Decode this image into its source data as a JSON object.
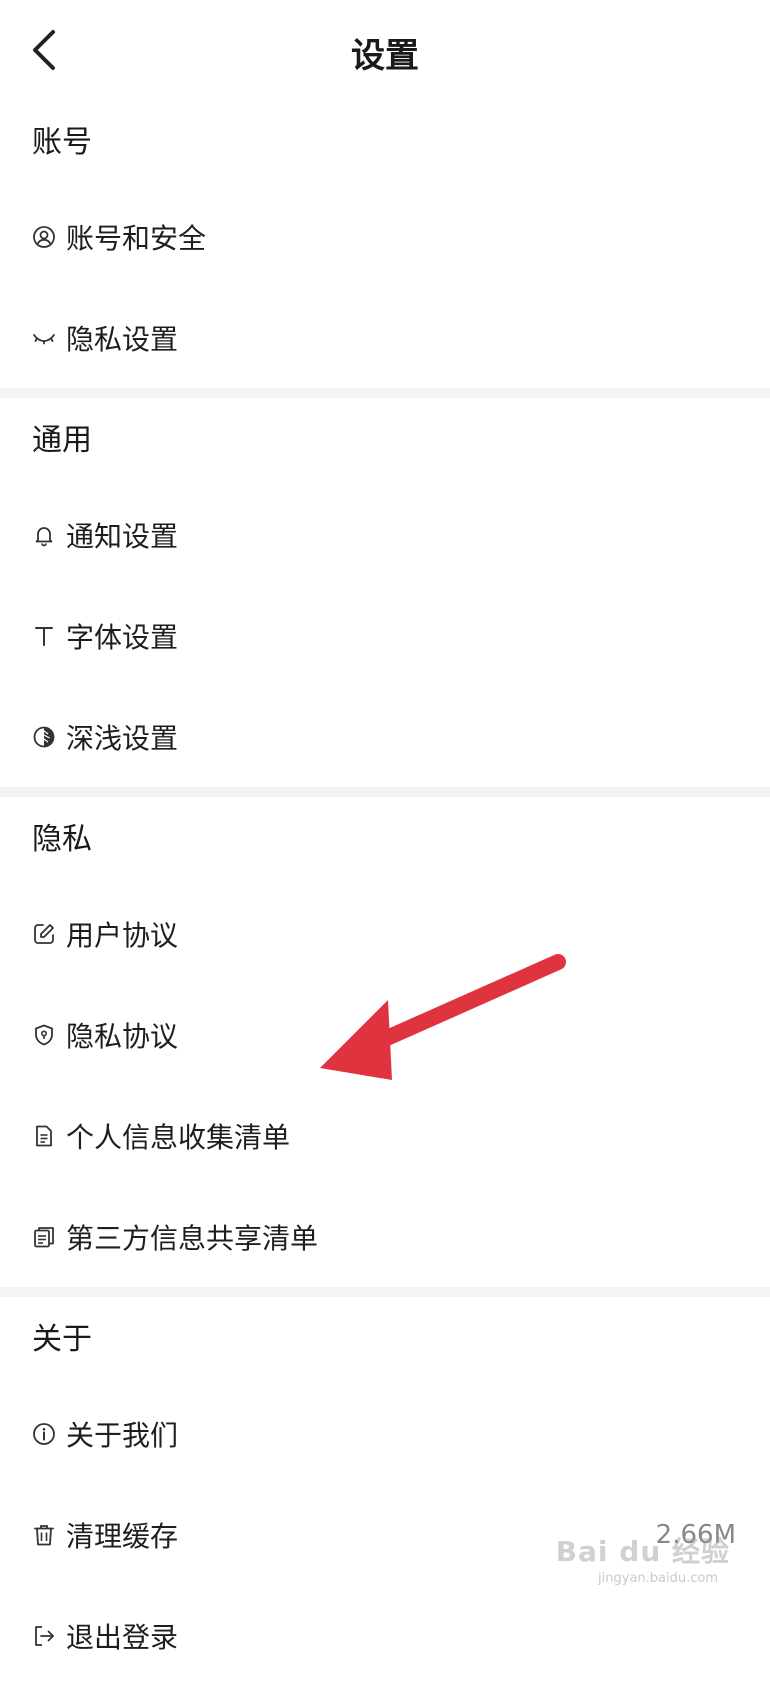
{
  "header": {
    "title": "设置",
    "back_icon": "chevron-left-icon"
  },
  "sections": [
    {
      "title": "账号",
      "items": [
        {
          "label": "账号和安全",
          "icon": "user-circle-icon"
        },
        {
          "label": "隐私设置",
          "icon": "closed-eye-icon"
        }
      ]
    },
    {
      "title": "通用",
      "items": [
        {
          "label": "通知设置",
          "icon": "bell-icon"
        },
        {
          "label": "字体设置",
          "icon": "text-t-icon"
        },
        {
          "label": "深浅设置",
          "icon": "contrast-icon"
        }
      ]
    },
    {
      "title": "隐私",
      "items": [
        {
          "label": "用户协议",
          "icon": "edit-square-icon"
        },
        {
          "label": "隐私协议",
          "icon": "shield-icon"
        },
        {
          "label": "个人信息收集清单",
          "icon": "document-icon"
        },
        {
          "label": "第三方信息共享清单",
          "icon": "documents-stack-icon"
        }
      ]
    },
    {
      "title": "关于",
      "items": [
        {
          "label": "关于我们",
          "icon": "info-circle-icon"
        },
        {
          "label": "清理缓存",
          "icon": "trash-icon",
          "value": "2.66M"
        },
        {
          "label": "退出登录",
          "icon": "logout-icon"
        }
      ]
    }
  ],
  "annotation": {
    "arrow_color": "#e03340",
    "arrow_icon": "red-arrow-annotation"
  },
  "watermark": {
    "text": "Bai du 经验",
    "sub": "jingyan.baidu.com"
  }
}
